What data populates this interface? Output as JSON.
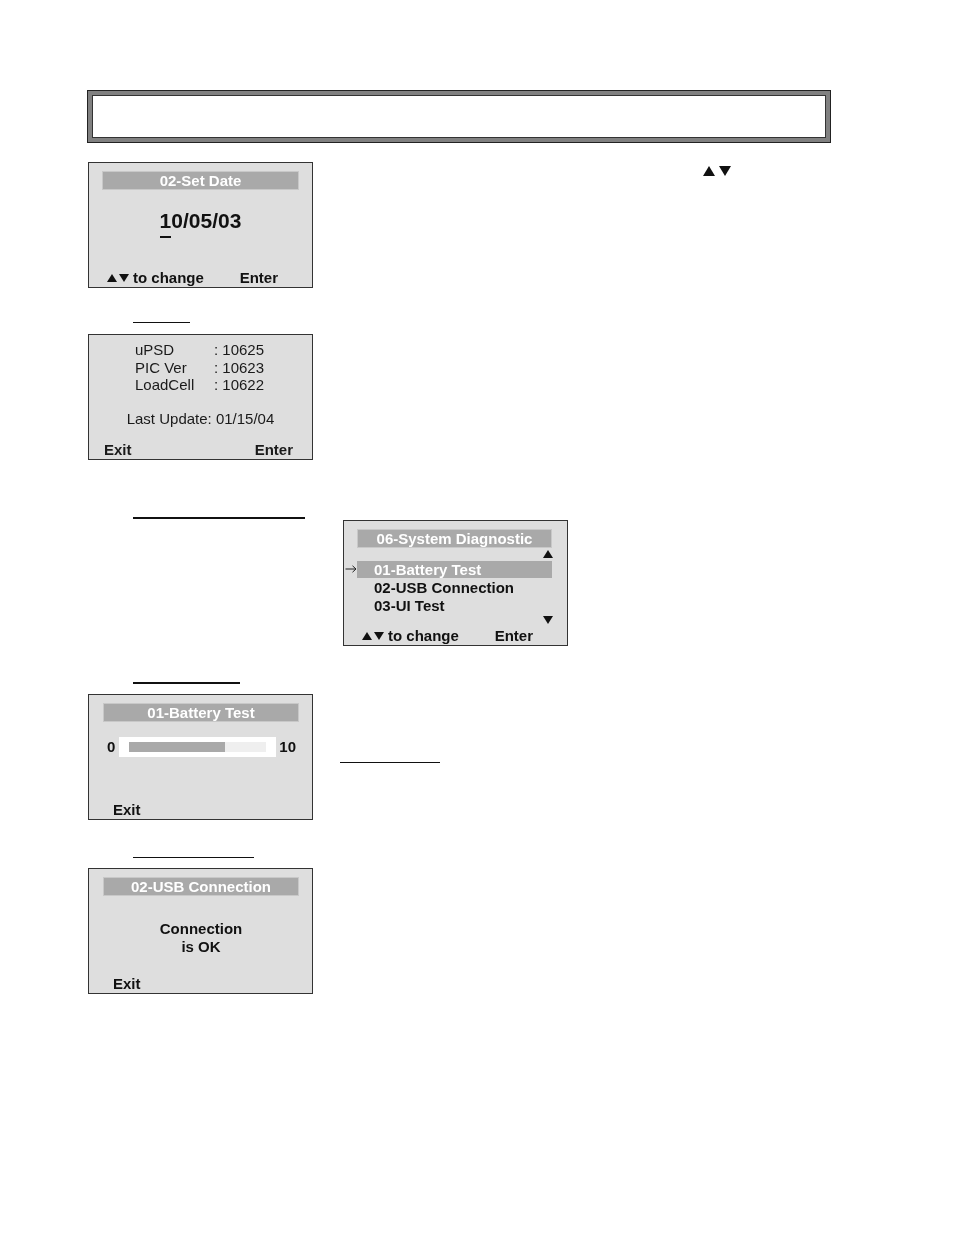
{
  "set_date_screen": {
    "title": "02-Set Date",
    "date_segments": [
      {
        "text": "1",
        "cursor": true
      },
      {
        "text": "0/05/03",
        "cursor": false
      }
    ],
    "hint": "to change",
    "action": "Enter"
  },
  "version_screen": {
    "rows": [
      {
        "label": "uPSD",
        "value": ": 10625"
      },
      {
        "label": "PIC Ver",
        "value": ": 10623"
      },
      {
        "label": "LoadCell",
        "value": ": 10622"
      }
    ],
    "last_update": "Last Update: 01/15/04",
    "left_key": "Exit",
    "right_key": "Enter"
  },
  "diagnostic_screen": {
    "title": "06-System Diagnostic",
    "items": [
      {
        "label": "01-Battery Test",
        "selected": true
      },
      {
        "label": "02-USB Connection",
        "selected": false
      },
      {
        "label": "03-UI Test",
        "selected": false
      }
    ],
    "hint": "to change",
    "action": "Enter"
  },
  "battery_screen": {
    "title": "01-Battery Test",
    "scale_min": "0",
    "scale_max": "10",
    "level": 0.7,
    "left_key": "Exit"
  },
  "usb_screen": {
    "title": "02-USB Connection",
    "message": "Connection\nis OK",
    "left_key": "Exit"
  }
}
